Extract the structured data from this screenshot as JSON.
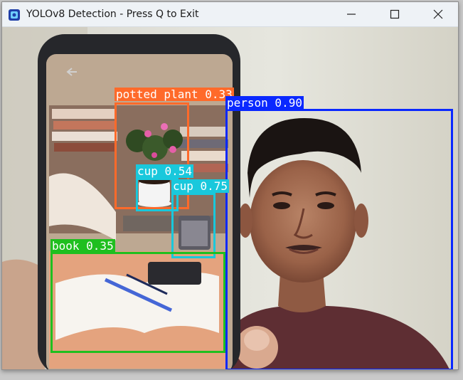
{
  "window": {
    "title": "YOLOv8 Detection - Press Q to Exit",
    "controls": [
      "minimize-icon",
      "maximize-icon",
      "close-icon"
    ]
  },
  "detections": [
    {
      "label": "potted plant 0.33",
      "color": "#ff6a2a"
    },
    {
      "label": "person 0.90",
      "color": "#0a28ff"
    },
    {
      "label": "cup 0.54",
      "color": "#19c8dc"
    },
    {
      "label": "cup 0.75",
      "color": "#19c8dc"
    },
    {
      "label": "book 0.35",
      "color": "#1fbf1f"
    }
  ]
}
